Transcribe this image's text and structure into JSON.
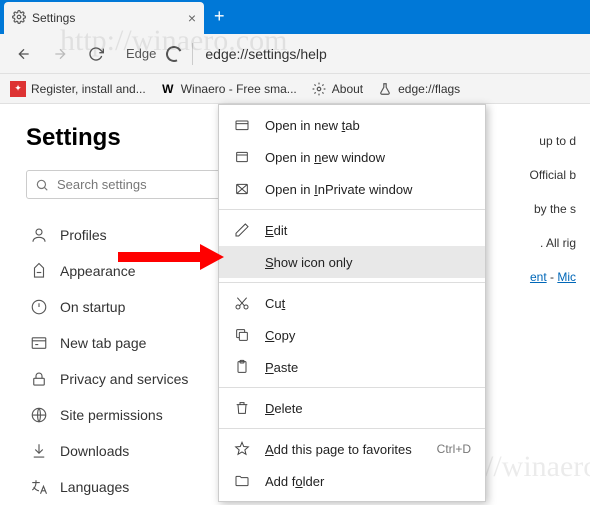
{
  "tab": {
    "title": "Settings"
  },
  "toolbar": {
    "label": "Edge",
    "url": "edge://settings/help"
  },
  "bookmarks": [
    {
      "label": "Register, install and..."
    },
    {
      "label": "Winaero - Free sma..."
    },
    {
      "label": "About"
    },
    {
      "label": "edge://flags"
    }
  ],
  "sidebar": {
    "heading": "Settings",
    "search_placeholder": "Search settings",
    "items": [
      {
        "label": "Profiles"
      },
      {
        "label": "Appearance"
      },
      {
        "label": "On startup"
      },
      {
        "label": "New tab page"
      },
      {
        "label": "Privacy and services"
      },
      {
        "label": "Site permissions"
      },
      {
        "label": "Downloads"
      },
      {
        "label": "Languages"
      }
    ]
  },
  "main": {
    "line1": "up to d",
    "line2": "Official b",
    "line3": "by the s",
    "line4": ". All rig",
    "link1": "ent",
    "link2": "Mic"
  },
  "context_menu": {
    "open_tab": "Open in new tab",
    "open_window": "Open in new window",
    "open_inprivate": "Open in InPrivate window",
    "edit": "Edit",
    "show_icon": "Show icon only",
    "cut": "Cut",
    "copy": "Copy",
    "paste": "Paste",
    "delete": "Delete",
    "add_fav": "Add this page to favorites",
    "add_fav_short": "Ctrl+D",
    "add_folder": "Add folder"
  },
  "watermark": "http://winaero.com"
}
